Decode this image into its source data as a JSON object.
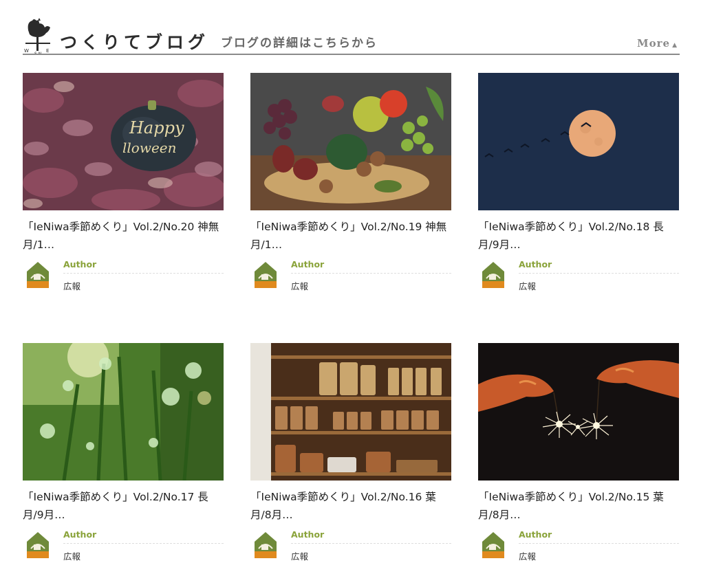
{
  "header": {
    "title": "つくりてブログ",
    "subtitle": "ブログの詳細はこちらから",
    "more_label": "More",
    "logo_icon": "rooster-weathervane-icon"
  },
  "posts": [
    {
      "title": "「IeNiwa季節めくり」Vol.2/No.20 神無月/1…",
      "author_label": "Author",
      "author_name": "広報",
      "image": "halloween-pumpkin"
    },
    {
      "title": "「IeNiwa季節めくり」Vol.2/No.19 神無月/1…",
      "author_label": "Author",
      "author_name": "広報",
      "image": "autumn-harvest-basket"
    },
    {
      "title": "「IeNiwa季節めくり」Vol.2/No.18 長月/9月…",
      "author_label": "Author",
      "author_name": "広報",
      "image": "full-moon-birds"
    },
    {
      "title": "「IeNiwa季節めくり」Vol.2/No.17 長月/9月…",
      "author_label": "Author",
      "author_name": "広報",
      "image": "dewdrops-on-grass"
    },
    {
      "title": "「IeNiwa季節めくり」Vol.2/No.16 葉月/8月…",
      "author_label": "Author",
      "author_name": "広報",
      "image": "pantry-jars-shelves"
    },
    {
      "title": "「IeNiwa季節めくり」Vol.2/No.15 葉月/8月…",
      "author_label": "Author",
      "author_name": "広報",
      "image": "sparklers-hands"
    }
  ],
  "colors": {
    "author_accent": "#8aa33a",
    "rule": "#8a8a8a",
    "avatar_orange": "#e08a1e",
    "avatar_green": "#6f8a3a"
  }
}
